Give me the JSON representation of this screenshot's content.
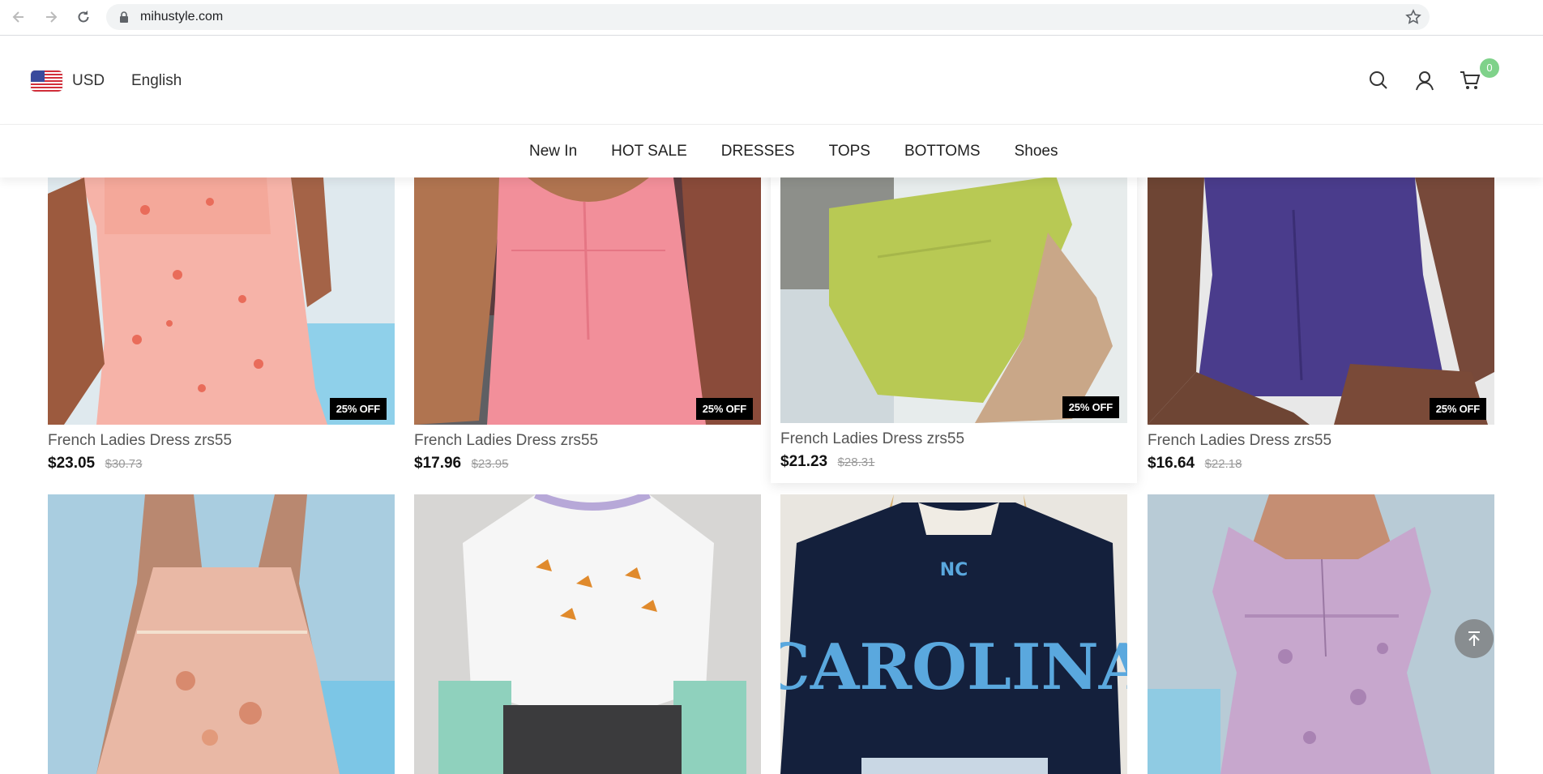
{
  "browser": {
    "url": "mihustyle.com"
  },
  "header": {
    "currency": "USD",
    "language": "English",
    "cart_count": "0",
    "accent_color": "#7fd28a"
  },
  "nav": {
    "items": [
      "New In",
      "HOT SALE",
      "DRESSES",
      "TOPS",
      "BOTTOMS",
      "Shoes"
    ]
  },
  "products": [
    {
      "title": "French Ladies Dress zrs55",
      "price": "$23.05",
      "old_price": "$30.73",
      "badge": "25% OFF"
    },
    {
      "title": "French Ladies Dress zrs55",
      "price": "$17.96",
      "old_price": "$23.95",
      "badge": "25% OFF"
    },
    {
      "title": "French Ladies Dress zrs55",
      "price": "$21.23",
      "old_price": "$28.31",
      "badge": "25% OFF"
    },
    {
      "title": "French Ladies Dress zrs55",
      "price": "$16.64",
      "old_price": "$22.18",
      "badge": "25% OFF"
    }
  ],
  "second_row": {
    "sweatshirt_text": "CAROLINA"
  }
}
